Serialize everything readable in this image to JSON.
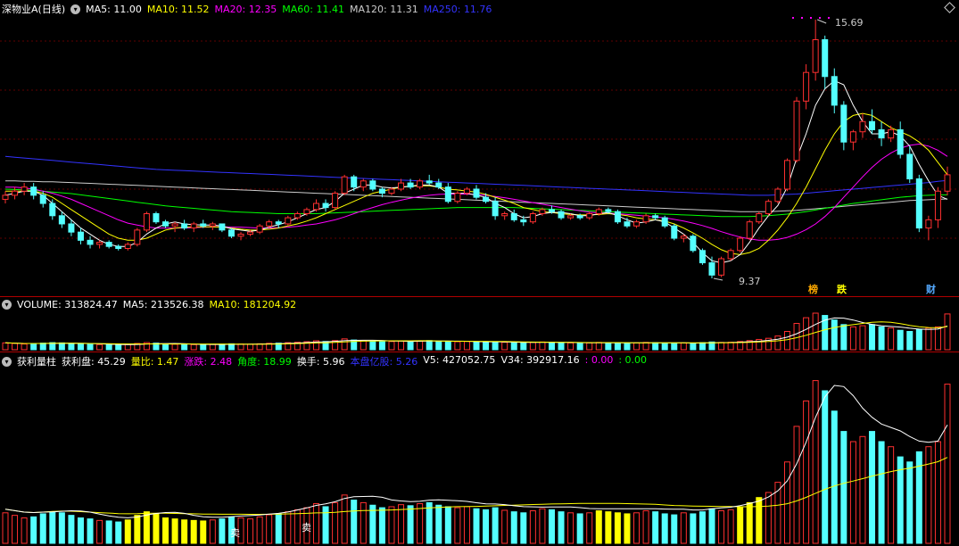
{
  "stock": {
    "title": "深物业A(日线)"
  },
  "main_header": {
    "items": [
      {
        "label": "MA5: 11.00",
        "color": "#ffffff"
      },
      {
        "label": "MA10: 11.52",
        "color": "#ffff00"
      },
      {
        "label": "MA20: 12.35",
        "color": "#ff00ff"
      },
      {
        "label": "MA60: 11.41",
        "color": "#00ff00"
      },
      {
        "label": "MA120: 11.31",
        "color": "#cccccc"
      },
      {
        "label": "MA250: 11.76",
        "color": "#3333ff"
      }
    ]
  },
  "main_annotations": {
    "high_label": "15.69",
    "low_label": "9.37",
    "tags": [
      {
        "text": "榜",
        "color": "#ffaa00"
      },
      {
        "text": "跌",
        "color": "#ffff00"
      },
      {
        "text": "财",
        "color": "#55aaff"
      }
    ]
  },
  "volume_header": {
    "items": [
      {
        "label": "VOLUME: 313824.47",
        "color": "#ffffff"
      },
      {
        "label": "MA5: 213526.38",
        "color": "#ffffff"
      },
      {
        "label": "MA10: 181204.92",
        "color": "#ffff00"
      }
    ]
  },
  "indicator_header": {
    "items": [
      {
        "label": "获利量柱",
        "color": "#ffffff"
      },
      {
        "label": "获利盘: 45.29",
        "color": "#ffffff"
      },
      {
        "label": "量比: 1.47",
        "color": "#ffff00"
      },
      {
        "label": "涨跌: 2.48",
        "color": "#ff00ff"
      },
      {
        "label": "角度: 18.99",
        "color": "#00ff00"
      },
      {
        "label": "换手: 5.96",
        "color": "#ffffff"
      },
      {
        "label": "本盘亿股: 5.26",
        "color": "#3333ff"
      },
      {
        "label": "V5: 427052.75",
        "color": "#ffffff"
      },
      {
        "label": "V34: 392917.16",
        "color": "#ffffff"
      },
      {
        "label": ": 0.00",
        "color": "#ff00ff"
      },
      {
        "label": ": 0.00",
        "color": "#00ff00"
      }
    ]
  },
  "indicator_annotations": {
    "sell_labels": [
      "卖",
      "卖"
    ]
  },
  "colors": {
    "up": "#ff3030",
    "down": "#54ffff",
    "ind_yellow": "#ffff00",
    "ind_cyan": "#54ffff",
    "ind_red": "#ff3030"
  },
  "chart_data": {
    "type": "candlestick",
    "price_range": [
      9.0,
      16.0
    ],
    "price_at_top": 15.69,
    "price_at_bottom": 9.37,
    "ohlc": [
      [
        11.3,
        11.5,
        11.2,
        11.4
      ],
      [
        11.4,
        11.6,
        11.3,
        11.5
      ],
      [
        11.5,
        11.7,
        11.4,
        11.6
      ],
      [
        11.6,
        11.7,
        11.3,
        11.4
      ],
      [
        11.4,
        11.5,
        11.1,
        11.2
      ],
      [
        11.2,
        11.3,
        10.8,
        10.9
      ],
      [
        10.9,
        11.0,
        10.6,
        10.7
      ],
      [
        10.7,
        10.8,
        10.4,
        10.5
      ],
      [
        10.5,
        10.6,
        10.2,
        10.3
      ],
      [
        10.3,
        10.4,
        10.1,
        10.2
      ],
      [
        10.2,
        10.3,
        10.1,
        10.25
      ],
      [
        10.25,
        10.3,
        10.1,
        10.15
      ],
      [
        10.15,
        10.2,
        10.05,
        10.1
      ],
      [
        10.1,
        10.25,
        10.05,
        10.2
      ],
      [
        10.2,
        10.6,
        10.15,
        10.55
      ],
      [
        10.55,
        11.0,
        10.5,
        10.95
      ],
      [
        10.95,
        11.0,
        10.7,
        10.75
      ],
      [
        10.75,
        10.8,
        10.6,
        10.65
      ],
      [
        10.65,
        10.75,
        10.5,
        10.7
      ],
      [
        10.7,
        10.8,
        10.55,
        10.6
      ],
      [
        10.6,
        10.75,
        10.5,
        10.7
      ],
      [
        10.7,
        10.8,
        10.6,
        10.65
      ],
      [
        10.65,
        10.75,
        10.55,
        10.7
      ],
      [
        10.7,
        10.7,
        10.5,
        10.55
      ],
      [
        10.55,
        10.6,
        10.35,
        10.4
      ],
      [
        10.4,
        10.5,
        10.3,
        10.45
      ],
      [
        10.45,
        10.55,
        10.4,
        10.5
      ],
      [
        10.5,
        10.7,
        10.45,
        10.65
      ],
      [
        10.65,
        10.8,
        10.6,
        10.75
      ],
      [
        10.75,
        10.8,
        10.6,
        10.7
      ],
      [
        10.7,
        10.9,
        10.65,
        10.85
      ],
      [
        10.85,
        11.0,
        10.8,
        10.95
      ],
      [
        10.95,
        11.1,
        10.9,
        11.05
      ],
      [
        11.05,
        11.3,
        11.0,
        11.2
      ],
      [
        11.2,
        11.3,
        11.0,
        11.1
      ],
      [
        11.1,
        11.5,
        11.05,
        11.45
      ],
      [
        11.45,
        11.9,
        11.4,
        11.85
      ],
      [
        11.85,
        11.9,
        11.5,
        11.6
      ],
      [
        11.6,
        11.8,
        11.5,
        11.75
      ],
      [
        11.75,
        11.8,
        11.5,
        11.55
      ],
      [
        11.55,
        11.6,
        11.35,
        11.45
      ],
      [
        11.45,
        11.6,
        11.4,
        11.55
      ],
      [
        11.55,
        11.8,
        11.5,
        11.7
      ],
      [
        11.7,
        11.8,
        11.55,
        11.6
      ],
      [
        11.6,
        11.8,
        11.55,
        11.75
      ],
      [
        11.75,
        11.9,
        11.65,
        11.7
      ],
      [
        11.7,
        11.8,
        11.55,
        11.6
      ],
      [
        11.6,
        11.7,
        11.2,
        11.25
      ],
      [
        11.25,
        11.5,
        11.2,
        11.45
      ],
      [
        11.45,
        11.6,
        11.4,
        11.55
      ],
      [
        11.55,
        11.65,
        11.3,
        11.35
      ],
      [
        11.35,
        11.45,
        11.2,
        11.25
      ],
      [
        11.25,
        11.35,
        10.8,
        10.9
      ],
      [
        10.9,
        11.0,
        10.8,
        10.95
      ],
      [
        10.95,
        11.05,
        10.75,
        10.8
      ],
      [
        10.8,
        10.9,
        10.65,
        10.75
      ],
      [
        10.75,
        11.0,
        10.7,
        10.95
      ],
      [
        10.95,
        11.1,
        10.9,
        11.05
      ],
      [
        11.05,
        11.15,
        10.95,
        11.0
      ],
      [
        11.0,
        11.05,
        10.8,
        10.85
      ],
      [
        10.85,
        10.95,
        10.8,
        10.9
      ],
      [
        10.9,
        10.95,
        10.8,
        10.85
      ],
      [
        10.85,
        11.0,
        10.8,
        10.95
      ],
      [
        10.95,
        11.1,
        10.9,
        11.05
      ],
      [
        11.05,
        11.1,
        10.95,
        11.0
      ],
      [
        11.0,
        11.05,
        10.7,
        10.75
      ],
      [
        10.75,
        10.85,
        10.6,
        10.65
      ],
      [
        10.65,
        10.8,
        10.6,
        10.75
      ],
      [
        10.75,
        10.95,
        10.7,
        10.9
      ],
      [
        10.9,
        10.95,
        10.8,
        10.85
      ],
      [
        10.85,
        10.9,
        10.6,
        10.65
      ],
      [
        10.65,
        10.7,
        10.3,
        10.35
      ],
      [
        10.35,
        10.45,
        10.25,
        10.4
      ],
      [
        10.4,
        10.45,
        10.0,
        10.05
      ],
      [
        10.05,
        10.1,
        9.7,
        9.75
      ],
      [
        9.75,
        9.9,
        9.37,
        9.45
      ],
      [
        9.45,
        9.9,
        9.4,
        9.85
      ],
      [
        9.85,
        10.1,
        9.8,
        10.05
      ],
      [
        10.05,
        10.4,
        10.0,
        10.35
      ],
      [
        10.35,
        10.8,
        10.3,
        10.75
      ],
      [
        10.75,
        11.0,
        10.7,
        10.95
      ],
      [
        10.95,
        11.3,
        10.9,
        11.25
      ],
      [
        11.25,
        11.6,
        11.2,
        11.55
      ],
      [
        11.55,
        12.3,
        11.5,
        12.25
      ],
      [
        12.25,
        13.8,
        12.2,
        13.7
      ],
      [
        13.7,
        14.6,
        13.5,
        14.4
      ],
      [
        14.4,
        15.69,
        14.2,
        15.2
      ],
      [
        15.2,
        15.3,
        14.0,
        14.3
      ],
      [
        14.3,
        14.5,
        13.4,
        13.6
      ],
      [
        13.6,
        13.7,
        12.5,
        12.7
      ],
      [
        12.7,
        13.0,
        12.5,
        12.95
      ],
      [
        12.95,
        13.4,
        12.8,
        13.2
      ],
      [
        13.2,
        13.5,
        12.9,
        13.0
      ],
      [
        13.0,
        13.2,
        12.6,
        12.8
      ],
      [
        12.8,
        13.1,
        12.7,
        13.0
      ],
      [
        13.0,
        13.2,
        12.3,
        12.4
      ],
      [
        12.4,
        12.6,
        11.7,
        11.8
      ],
      [
        11.8,
        11.9,
        10.5,
        10.6
      ],
      [
        10.6,
        10.9,
        10.3,
        10.8
      ],
      [
        10.8,
        11.6,
        10.6,
        11.5
      ],
      [
        11.5,
        12.1,
        11.4,
        11.9
      ]
    ],
    "ma5": [
      11.4,
      11.45,
      11.5,
      11.5,
      11.4,
      11.2,
      11.0,
      10.8,
      10.6,
      10.45,
      10.3,
      10.2,
      10.15,
      10.15,
      10.25,
      10.45,
      10.6,
      10.7,
      10.75,
      10.7,
      10.68,
      10.67,
      10.67,
      10.65,
      10.58,
      10.55,
      10.52,
      10.55,
      10.62,
      10.68,
      10.75,
      10.85,
      10.95,
      11.05,
      11.1,
      11.25,
      11.45,
      11.55,
      11.65,
      11.65,
      11.6,
      11.58,
      11.6,
      11.62,
      11.65,
      11.65,
      11.6,
      11.45,
      11.45,
      11.45,
      11.4,
      11.35,
      11.2,
      11.1,
      10.95,
      10.85,
      10.88,
      10.95,
      10.98,
      10.98,
      10.95,
      10.9,
      10.9,
      10.95,
      10.98,
      10.9,
      10.8,
      10.72,
      10.75,
      10.8,
      10.75,
      10.6,
      10.45,
      10.25,
      10.0,
      9.8,
      9.75,
      9.8,
      9.95,
      10.25,
      10.6,
      10.9,
      11.15,
      11.6,
      12.3,
      12.9,
      13.6,
      14.0,
      14.2,
      14.1,
      13.6,
      13.2,
      12.9,
      12.9,
      12.95,
      12.85,
      12.6,
      12.15,
      11.75,
      11.4,
      11.3
    ],
    "ma10": [
      11.5,
      11.5,
      11.5,
      11.5,
      11.45,
      11.35,
      11.2,
      11.05,
      10.9,
      10.75,
      10.6,
      10.45,
      10.35,
      10.3,
      10.3,
      10.35,
      10.45,
      10.55,
      10.6,
      10.62,
      10.63,
      10.63,
      10.63,
      10.62,
      10.6,
      10.57,
      10.55,
      10.55,
      10.57,
      10.6,
      10.65,
      10.7,
      10.77,
      10.85,
      10.95,
      11.05,
      11.15,
      11.25,
      11.35,
      11.45,
      11.5,
      11.55,
      11.6,
      11.62,
      11.63,
      11.63,
      11.6,
      11.55,
      11.53,
      11.5,
      11.48,
      11.42,
      11.35,
      11.28,
      11.2,
      11.1,
      11.05,
      11.0,
      10.98,
      10.95,
      10.93,
      10.92,
      10.92,
      10.93,
      10.95,
      10.93,
      10.9,
      10.85,
      10.82,
      10.8,
      10.77,
      10.7,
      10.6,
      10.48,
      10.35,
      10.2,
      10.07,
      9.98,
      9.95,
      10.0,
      10.1,
      10.3,
      10.55,
      10.85,
      11.2,
      11.6,
      12.05,
      12.5,
      12.9,
      13.2,
      13.35,
      13.4,
      13.35,
      13.2,
      13.05,
      12.95,
      12.85,
      12.7,
      12.5,
      12.2,
      11.9
    ],
    "ma20": [
      11.6,
      11.6,
      11.58,
      11.55,
      11.5,
      11.45,
      11.38,
      11.3,
      11.2,
      11.1,
      11.0,
      10.9,
      10.8,
      10.72,
      10.67,
      10.63,
      10.6,
      10.6,
      10.6,
      10.6,
      10.61,
      10.62,
      10.63,
      10.63,
      10.62,
      10.62,
      10.61,
      10.6,
      10.6,
      10.61,
      10.62,
      10.64,
      10.67,
      10.7,
      10.75,
      10.8,
      10.87,
      10.95,
      11.03,
      11.1,
      11.17,
      11.23,
      11.28,
      11.33,
      11.37,
      11.4,
      11.42,
      11.43,
      11.43,
      11.43,
      11.42,
      11.4,
      11.37,
      11.34,
      11.3,
      11.26,
      11.22,
      11.18,
      11.14,
      11.1,
      11.06,
      11.02,
      10.99,
      10.97,
      10.96,
      10.95,
      10.93,
      10.91,
      10.89,
      10.87,
      10.85,
      10.81,
      10.77,
      10.72,
      10.66,
      10.59,
      10.51,
      10.44,
      10.38,
      10.33,
      10.3,
      10.3,
      10.32,
      10.37,
      10.45,
      10.56,
      10.7,
      10.88,
      11.1,
      11.35,
      11.6,
      11.85,
      12.08,
      12.28,
      12.43,
      12.55,
      12.62,
      12.65,
      12.6,
      12.5,
      12.35
    ],
    "ma60": [
      11.55,
      11.54,
      11.53,
      11.52,
      11.5,
      11.48,
      11.46,
      11.44,
      11.41,
      11.38,
      11.35,
      11.32,
      11.29,
      11.26,
      11.23,
      11.2,
      11.17,
      11.14,
      11.12,
      11.1,
      11.08,
      11.06,
      11.04,
      11.02,
      11.0,
      10.99,
      10.98,
      10.97,
      10.96,
      10.95,
      10.95,
      10.95,
      10.95,
      10.95,
      10.96,
      10.97,
      10.98,
      10.99,
      11.0,
      11.01,
      11.02,
      11.03,
      11.04,
      11.05,
      11.06,
      11.07,
      11.08,
      11.09,
      11.1,
      11.1,
      11.1,
      11.1,
      11.1,
      11.1,
      11.1,
      11.09,
      11.08,
      11.07,
      11.06,
      11.05,
      11.04,
      11.03,
      11.02,
      11.01,
      11.0,
      10.99,
      10.98,
      10.97,
      10.96,
      10.95,
      10.94,
      10.93,
      10.92,
      10.91,
      10.9,
      10.89,
      10.88,
      10.88,
      10.88,
      10.88,
      10.89,
      10.9,
      10.92,
      10.94,
      10.97,
      11.0,
      11.04,
      11.08,
      11.12,
      11.16,
      11.2,
      11.23,
      11.26,
      11.29,
      11.32,
      11.35,
      11.37,
      11.39,
      11.4,
      11.41,
      11.41
    ],
    "ma120": [
      11.75,
      11.75,
      11.74,
      11.74,
      11.73,
      11.73,
      11.72,
      11.71,
      11.7,
      11.69,
      11.68,
      11.67,
      11.66,
      11.65,
      11.64,
      11.63,
      11.62,
      11.61,
      11.6,
      11.59,
      11.58,
      11.57,
      11.56,
      11.55,
      11.54,
      11.53,
      11.52,
      11.51,
      11.5,
      11.49,
      11.48,
      11.47,
      11.46,
      11.45,
      11.44,
      11.43,
      11.42,
      11.41,
      11.4,
      11.39,
      11.38,
      11.37,
      11.36,
      11.35,
      11.34,
      11.33,
      11.32,
      11.31,
      11.3,
      11.29,
      11.28,
      11.27,
      11.26,
      11.25,
      11.24,
      11.23,
      11.22,
      11.21,
      11.2,
      11.19,
      11.18,
      11.17,
      11.16,
      11.15,
      11.14,
      11.13,
      11.12,
      11.11,
      11.1,
      11.09,
      11.08,
      11.07,
      11.06,
      11.05,
      11.04,
      11.03,
      11.02,
      11.01,
      11.0,
      11.0,
      11.0,
      11.0,
      11.01,
      11.02,
      11.03,
      11.05,
      11.07,
      11.09,
      11.11,
      11.13,
      11.15,
      11.17,
      11.19,
      11.21,
      11.23,
      11.25,
      11.27,
      11.28,
      11.29,
      11.3,
      11.31
    ],
    "ma250": [
      12.35,
      12.33,
      12.31,
      12.29,
      12.27,
      12.25,
      12.23,
      12.21,
      12.19,
      12.17,
      12.15,
      12.13,
      12.11,
      12.09,
      12.07,
      12.05,
      12.03,
      12.02,
      12.01,
      12.0,
      11.99,
      11.98,
      11.97,
      11.96,
      11.95,
      11.94,
      11.93,
      11.92,
      11.91,
      11.9,
      11.89,
      11.88,
      11.87,
      11.86,
      11.85,
      11.84,
      11.83,
      11.82,
      11.81,
      11.8,
      11.79,
      11.78,
      11.77,
      11.76,
      11.75,
      11.74,
      11.73,
      11.72,
      11.71,
      11.7,
      11.69,
      11.68,
      11.67,
      11.66,
      11.65,
      11.64,
      11.63,
      11.62,
      11.61,
      11.6,
      11.59,
      11.58,
      11.57,
      11.56,
      11.55,
      11.54,
      11.53,
      11.52,
      11.51,
      11.5,
      11.49,
      11.48,
      11.47,
      11.46,
      11.45,
      11.44,
      11.43,
      11.42,
      11.41,
      11.4,
      11.4,
      11.4,
      11.41,
      11.42,
      11.43,
      11.45,
      11.47,
      11.49,
      11.51,
      11.53,
      11.55,
      11.57,
      11.59,
      11.61,
      11.63,
      11.65,
      11.67,
      11.69,
      11.71,
      11.74,
      11.76
    ],
    "volume": [
      60,
      55,
      50,
      52,
      58,
      62,
      60,
      55,
      50,
      48,
      45,
      44,
      42,
      46,
      55,
      62,
      58,
      50,
      48,
      46,
      45,
      44,
      46,
      48,
      52,
      50,
      48,
      52,
      56,
      58,
      62,
      66,
      70,
      78,
      72,
      80,
      95,
      85,
      80,
      75,
      70,
      72,
      76,
      74,
      78,
      80,
      75,
      72,
      70,
      72,
      68,
      66,
      70,
      65,
      62,
      60,
      64,
      68,
      66,
      62,
      60,
      58,
      60,
      64,
      62,
      60,
      58,
      60,
      64,
      62,
      58,
      56,
      60,
      58,
      62,
      68,
      64,
      66,
      72,
      80,
      90,
      100,
      120,
      160,
      230,
      280,
      320,
      300,
      260,
      220,
      200,
      210,
      220,
      200,
      190,
      170,
      160,
      180,
      190,
      200,
      313
    ]
  }
}
